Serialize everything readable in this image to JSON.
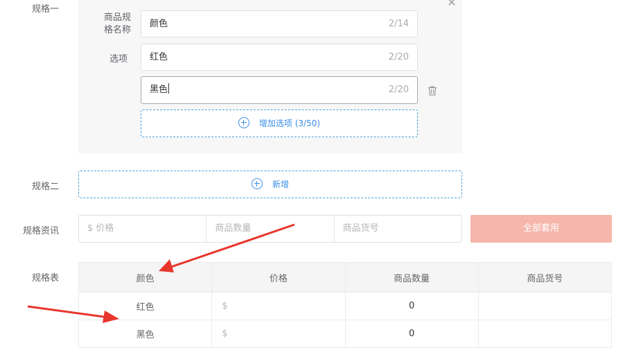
{
  "spec1": {
    "label": "规格一",
    "name_label": "商品规格名称",
    "name_value": "颜色",
    "name_count": "2/14",
    "options_label": "选项",
    "options": [
      {
        "value": "红色",
        "count": "2/20"
      },
      {
        "value": "黑色",
        "count": "2/20"
      }
    ],
    "add_option_label": "增加选项 (3/50)"
  },
  "spec2": {
    "label": "规格二",
    "add_label": "新增"
  },
  "spec_info": {
    "label": "规格资讯",
    "price_placeholder": "$ 价格",
    "quantity_placeholder": "商品数量",
    "sku_placeholder": "商品货号",
    "apply_all_label": "全部套用"
  },
  "spec_table": {
    "label": "规格表",
    "headers": [
      "颜色",
      "价格",
      "商品数量",
      "商品货号"
    ],
    "rows": [
      {
        "color": "红色",
        "price": "$",
        "quantity": "0",
        "sku": ""
      },
      {
        "color": "黑色",
        "price": "$",
        "quantity": "0",
        "sku": ""
      }
    ]
  },
  "colors": {
    "accent": "#3a8ee6",
    "apply_button": "#f6b6ab",
    "arrow": "#e8362d"
  },
  "icons": [
    "close-icon",
    "trash-icon",
    "plus-circle-icon",
    "arrow-annotation"
  ]
}
